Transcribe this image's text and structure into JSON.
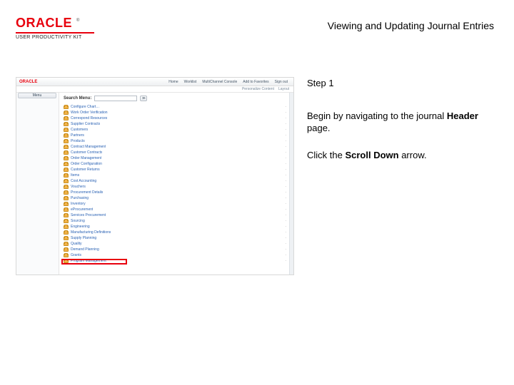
{
  "brand": {
    "name": "ORACLE",
    "tm": "®",
    "subtitle": "USER PRODUCTIVITY KIT"
  },
  "title": "Viewing and Updating Journal Entries",
  "instructions": {
    "step_label": "Step 1",
    "para1_a": "Begin by navigating to the journal ",
    "para1_bold": "Header",
    "para1_b": " page.",
    "para2_a": "Click the ",
    "para2_bold": "Scroll Down",
    "para2_b": " arrow."
  },
  "shot": {
    "side_pill": "Menu",
    "nav": [
      "Home",
      "Worklist",
      "MultiChannel Console",
      "Add to Favorites",
      "Sign out"
    ],
    "subnav": [
      "Personalize Content",
      "Layout"
    ],
    "search_label": "Search Menu:",
    "search_btn": "≫",
    "tree": [
      "Configure Chart…",
      "Work Order Verification",
      "Correspond Resources",
      "Supplier Contracts",
      "Customers",
      "Partners",
      "Products",
      "Contract Management",
      "Customer Contracts",
      "Order Management",
      "Order Configuration",
      "Customer Returns",
      "Items",
      "Cost Accounting",
      "Vouchers",
      "Procurement Details",
      "Purchasing",
      "Inventory",
      "eProcurement",
      "Services Procurement",
      "Sourcing",
      "Engineering",
      "Manufacturing Definitions",
      "Supply Planning",
      "Quality",
      "Demand Planning",
      "Grants",
      "Program Management"
    ]
  }
}
